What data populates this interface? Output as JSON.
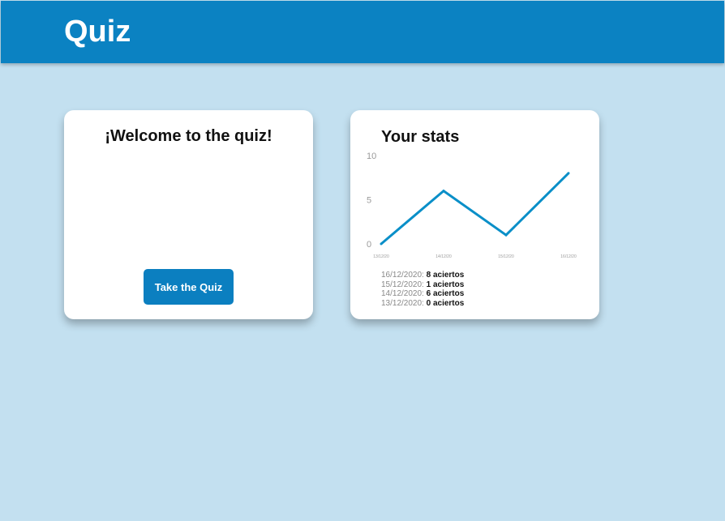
{
  "header": {
    "title": "Quiz"
  },
  "welcome_card": {
    "title": "¡Welcome to the quiz!",
    "button_label": "Take the Quiz"
  },
  "stats_card": {
    "title": "Your stats",
    "history": [
      {
        "date": "16/12/2020:",
        "score": "8 aciertos"
      },
      {
        "date": "15/12/2020:",
        "score": "1 aciertos"
      },
      {
        "date": "14/12/2020:",
        "score": "6 aciertos"
      },
      {
        "date": "13/12/2020:",
        "score": "0 aciertos"
      }
    ]
  },
  "colors": {
    "header_bg": "#0b82c2",
    "page_bg": "#c3e0f0",
    "line": "#0a8fc8",
    "button_bg": "#0b7fc0"
  },
  "chart_data": {
    "type": "line",
    "x": [
      "13/12/20",
      "14/12/20",
      "15/12/20",
      "16/12/20"
    ],
    "series": [
      {
        "values": [
          0,
          6,
          1,
          8
        ]
      }
    ],
    "yticks": [
      0,
      5,
      10
    ],
    "ylim": [
      0,
      10
    ],
    "grid": false
  }
}
